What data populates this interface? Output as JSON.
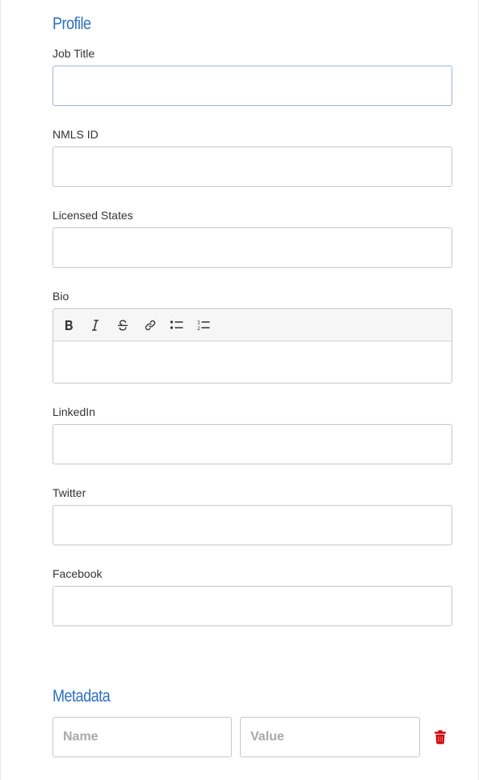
{
  "profile": {
    "title": "Profile",
    "fields": {
      "job_title": {
        "label": "Job Title",
        "value": ""
      },
      "nmls_id": {
        "label": "NMLS ID",
        "value": ""
      },
      "licensed_states": {
        "label": "Licensed States",
        "value": ""
      },
      "bio": {
        "label": "Bio",
        "value": "",
        "toolbar": [
          "bold-icon",
          "italic-icon",
          "strikethrough-icon",
          "link-icon",
          "bullet-list-icon",
          "numbered-list-icon"
        ]
      },
      "linkedin": {
        "label": "LinkedIn",
        "value": ""
      },
      "twitter": {
        "label": "Twitter",
        "value": ""
      },
      "facebook": {
        "label": "Facebook",
        "value": ""
      }
    }
  },
  "metadata": {
    "title": "Metadata",
    "row": {
      "name_placeholder": "Name",
      "value_placeholder": "Value",
      "name_value": "",
      "value_value": "",
      "delete_icon": "trash-icon"
    }
  },
  "colors": {
    "heading": "#2e6fbe",
    "label": "#333333",
    "border": "#c8c8c8",
    "focused_border": "#9fb8d4",
    "toolbar_bg": "#f6f6f6",
    "delete": "#cc0000"
  }
}
